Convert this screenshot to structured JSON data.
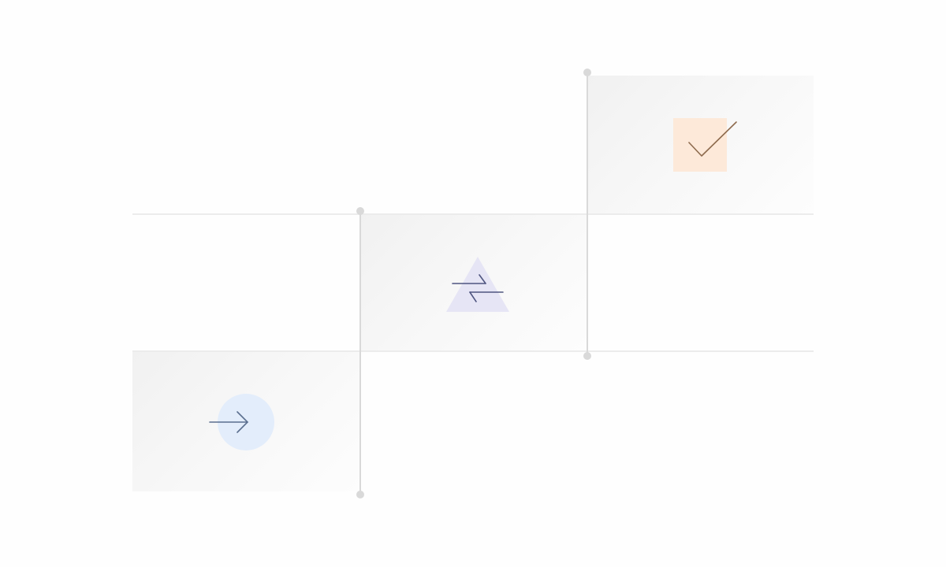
{
  "diagram": {
    "type": "step-sequence",
    "steps": [
      {
        "icon": "arrow-right-icon",
        "shape": "circle",
        "shape_color": "#e3edfb",
        "icon_color": "#5b6f8f"
      },
      {
        "icon": "swap-arrows-icon",
        "shape": "triangle",
        "shape_color": "#e6e5f5",
        "icon_color": "#4f5580"
      },
      {
        "icon": "checkmark-icon",
        "shape": "square",
        "shape_color": "#fde9d9",
        "icon_color": "#8e6b4e"
      }
    ],
    "colors": {
      "panel": "#f3f3f3",
      "divider": "#ececec",
      "connector": "#d9d9d9"
    }
  }
}
